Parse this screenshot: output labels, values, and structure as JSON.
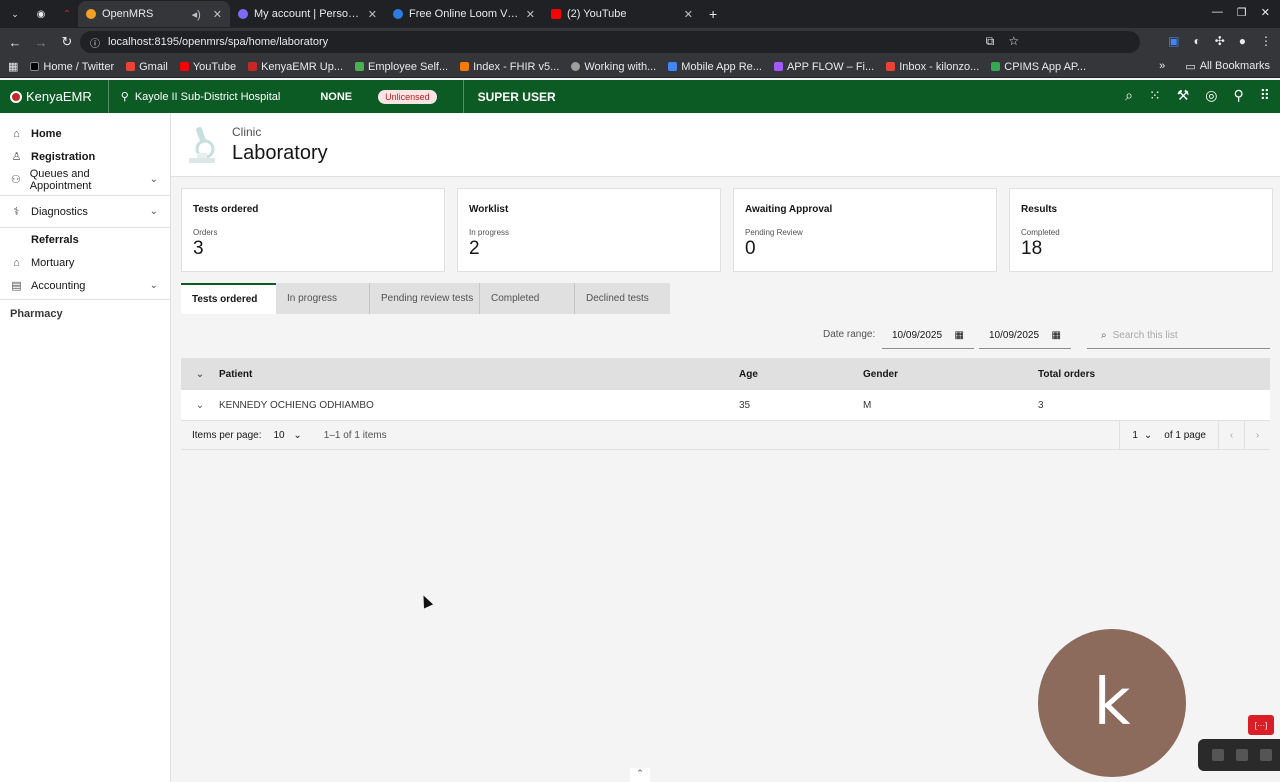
{
  "browser": {
    "tabs": [
      {
        "title": "OpenMRS",
        "color": "#f4a125",
        "active": true
      },
      {
        "title": "My account | Personal Se",
        "color": "#7b6cf6",
        "active": false
      },
      {
        "title": "Free Online Loom Video",
        "color": "#2a7de1",
        "active": false
      },
      {
        "title": "(2) YouTube",
        "color": "#ff0000",
        "active": false
      }
    ],
    "new_tab": "+",
    "url": "localhost:8195/openmrs/spa/home/laboratory",
    "bookmarks": [
      {
        "label": "Home / Twitter",
        "color": "#000000"
      },
      {
        "label": "Gmail",
        "color": "#ea4335"
      },
      {
        "label": "YouTube",
        "color": "#ff0000"
      },
      {
        "label": "KenyaEMR Up...",
        "color": "#c62828"
      },
      {
        "label": "Employee Self...",
        "color": "#4caf50"
      },
      {
        "label": "Index - FHIR v5...",
        "color": "#f57c00"
      },
      {
        "label": "Working with...",
        "color": "#9e9e9e"
      },
      {
        "label": "Mobile App Re...",
        "color": "#4285f4"
      },
      {
        "label": "APP FLOW – Fi...",
        "color": "#a259ff"
      },
      {
        "label": "Inbox - kilonzo...",
        "color": "#ea4335"
      },
      {
        "label": "CPIMS App AP...",
        "color": "#34a853"
      }
    ],
    "all_bookmarks": "All Bookmarks"
  },
  "header": {
    "brand": "KenyaEMR",
    "location": "Kayole II Sub-District Hospital",
    "environment": "NONE",
    "license": "Unlicensed",
    "user": "SUPER USER",
    "accent": "#0d5b24"
  },
  "sidebar": {
    "items": [
      {
        "label": "Home",
        "icon": "home-icon",
        "glyph": "⌂",
        "expandable": false
      },
      {
        "label": "Registration",
        "icon": "user-icon",
        "glyph": "♙",
        "expandable": false
      },
      {
        "label": "Queues and Appointment",
        "icon": "group-icon",
        "glyph": "⚇",
        "expandable": true
      },
      {
        "label": "Diagnostics",
        "icon": "stethoscope-icon",
        "glyph": "⚕",
        "expandable": true
      },
      {
        "label": "Referrals",
        "icon": "",
        "glyph": "",
        "expandable": false
      },
      {
        "label": "Mortuary",
        "icon": "building-icon",
        "glyph": "⌂",
        "expandable": false
      },
      {
        "label": "Accounting",
        "icon": "calculator-icon",
        "glyph": "▤",
        "expandable": true
      }
    ],
    "pharmacy": "Pharmacy"
  },
  "page": {
    "subtitle": "Clinic",
    "title": "Laboratory"
  },
  "tiles": [
    {
      "heading": "Tests ordered",
      "label": "Orders",
      "value": "3"
    },
    {
      "heading": "Worklist",
      "label": "In progress",
      "value": "2"
    },
    {
      "heading": "Awaiting Approval",
      "label": "Pending Review",
      "value": "0"
    },
    {
      "heading": "Results",
      "label": "Completed",
      "value": "18"
    }
  ],
  "tabs": [
    {
      "label": "Tests ordered",
      "active": true
    },
    {
      "label": "In progress",
      "active": false
    },
    {
      "label": "Pending review tests",
      "active": false
    },
    {
      "label": "Completed",
      "active": false
    },
    {
      "label": "Declined tests",
      "active": false
    }
  ],
  "filters": {
    "date_range_label": "Date range:",
    "start_date": "10/09/2025",
    "end_date": "10/09/2025",
    "search_placeholder": "Search this list"
  },
  "table": {
    "columns": [
      "Patient",
      "Age",
      "Gender",
      "Total orders"
    ],
    "rows": [
      {
        "patient": "KENNEDY OCHIENG ODHIAMBO",
        "age": "35",
        "gender": "M",
        "total_orders": "3"
      }
    ]
  },
  "pagination": {
    "items_per_page_label": "Items per page:",
    "items_per_page": "10",
    "range": "1–1 of 1 items",
    "page": "1",
    "of_pages": "of 1 page"
  },
  "overlay": {
    "avatar_letter": "k",
    "record_badge": "[···]"
  }
}
